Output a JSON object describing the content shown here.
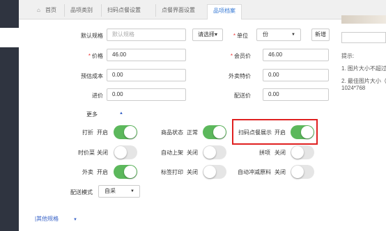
{
  "tabs": [
    {
      "label": "首页"
    },
    {
      "label": "品项类别"
    },
    {
      "label": "扫码点餐设置"
    },
    {
      "label": "点餐界面设置"
    },
    {
      "label": "品项档案"
    }
  ],
  "form": {
    "default_spec": {
      "label": "默认规格",
      "placeholder": "默认规格",
      "choose_button": "请选择▾"
    },
    "unit": {
      "label": "单位",
      "value": "份",
      "add_button": "新增"
    },
    "price": {
      "label": "价格",
      "value": "46.00"
    },
    "member_price": {
      "label": "会员价",
      "value": "46.00"
    },
    "est_cost": {
      "label": "预估成本",
      "value": "0.00"
    },
    "takeout_price": {
      "label": "外卖特价",
      "value": "0.00"
    },
    "purchase_price": {
      "label": "进价",
      "value": "0.00"
    },
    "delivery_price": {
      "label": "配送价",
      "value": "0.00"
    },
    "more": {
      "label": "更多"
    }
  },
  "toggles": {
    "discount": {
      "label": "打折",
      "status": "开启",
      "on": true
    },
    "item_status": {
      "label": "商品状态",
      "status": "正常",
      "on": true
    },
    "scan_display": {
      "label": "扫码点餐展示",
      "status": "开启",
      "on": true
    },
    "seasonal": {
      "label": "时价菜",
      "status": "关闭",
      "on": false
    },
    "auto_shelf": {
      "label": "自动上架",
      "status": "关闭",
      "on": false
    },
    "combo": {
      "label": "拼项",
      "status": "关闭",
      "on": false
    },
    "takeout": {
      "label": "外卖",
      "status": "开启",
      "on": true
    },
    "label_print": {
      "label": "标签打印",
      "status": "关闭",
      "on": false
    },
    "auto_deduct": {
      "label": "自动冲减原料",
      "status": "关闭",
      "on": false
    }
  },
  "delivery_mode": {
    "label": "配送模式",
    "value": "自采"
  },
  "other_specs": {
    "label": "|其他规格"
  },
  "tips": {
    "title": "提示:",
    "line1": "1. 图片大小不超过",
    "line2": "2. 最佳图片大小（",
    "line3": "1024*768"
  },
  "colors": {
    "accent": "#3a7bd5",
    "toggle_on": "#5cb85c",
    "highlight": "#e02020"
  }
}
